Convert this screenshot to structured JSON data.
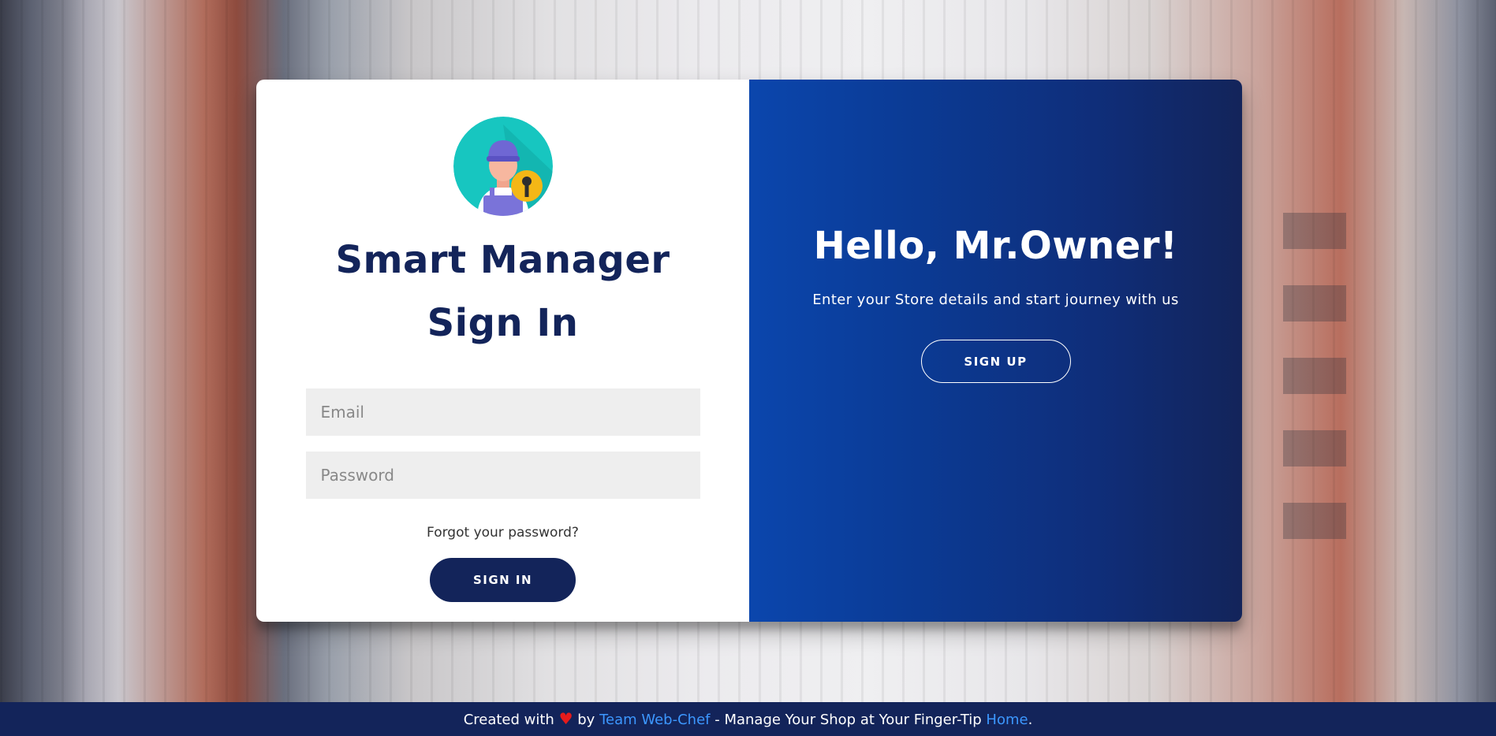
{
  "login": {
    "title_line1": "Smart Manager",
    "title_line2": "Sign In",
    "email_placeholder": "Email",
    "password_placeholder": "Password",
    "forgot_link": "Forgot your password?",
    "signin_label": "SIGN IN",
    "avatar_icon": "manager-with-key-avatar-icon"
  },
  "overlay": {
    "heading": "Hello, Mr.Owner!",
    "tagline": "Enter your Store details and start journey with us",
    "signup_label": "SIGN UP"
  },
  "footer": {
    "created_with": "Created with",
    "heart_icon": "heart-icon",
    "heart_glyph": "♥",
    "by": "by",
    "team_link": "Team Web-Chef",
    "middle_text": "- Manage Your Shop at Your Finger-Tip",
    "home_link": "Home",
    "period": "."
  },
  "colors": {
    "primary_navy": "#13245a",
    "gradient_blue": "#0b46ad",
    "link_blue": "#3c97ff",
    "heart_red": "#e61b1b",
    "input_bg": "#eeeeee"
  }
}
